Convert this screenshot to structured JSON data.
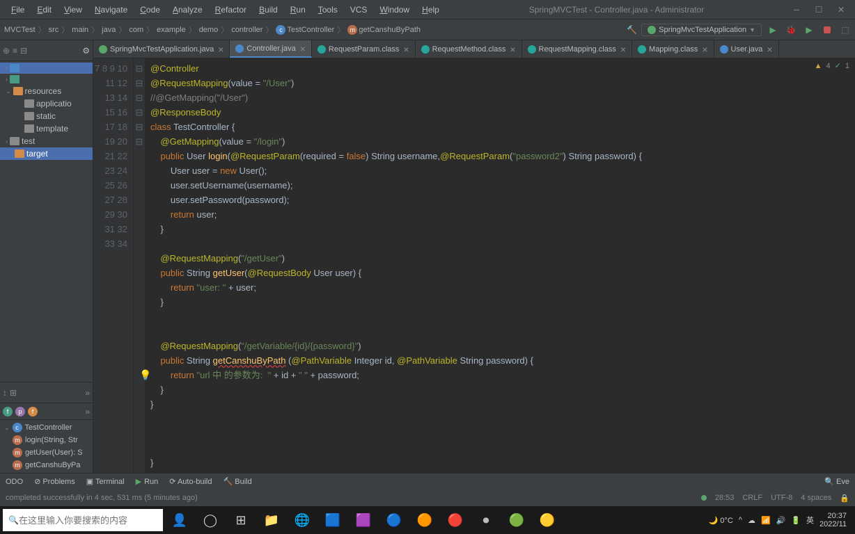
{
  "title": "SpringMVCTest - Controller.java - Administrator",
  "menu": [
    "File",
    "Edit",
    "View",
    "Navigate",
    "Code",
    "Analyze",
    "Refactor",
    "Build",
    "Run",
    "Tools",
    "VCS",
    "Window",
    "Help"
  ],
  "menu_underline": [
    0,
    0,
    0,
    0,
    0,
    0,
    0,
    0,
    0,
    0,
    -1,
    0,
    0
  ],
  "breadcrumbs": [
    "MVCTest",
    "src",
    "main",
    "java",
    "com",
    "example",
    "demo",
    "controller",
    "TestController",
    "getCanshuByPath"
  ],
  "run_config": "SpringMvcTestApplication",
  "tabs": [
    {
      "label": "SpringMvcTestApplication.java",
      "icon": "green",
      "active": false
    },
    {
      "label": "Controller.java",
      "icon": "blue",
      "active": true
    },
    {
      "label": "RequestParam.class",
      "icon": "teal",
      "active": false
    },
    {
      "label": "RequestMethod.class",
      "icon": "teal",
      "active": false
    },
    {
      "label": "RequestMapping.class",
      "icon": "teal",
      "active": false
    },
    {
      "label": "Mapping.class",
      "icon": "teal",
      "active": false
    },
    {
      "label": "User.java",
      "icon": "blue",
      "active": false
    }
  ],
  "tree": {
    "items": [
      {
        "label": "",
        "icon": "blue",
        "indent": 0,
        "chev": ">",
        "sel": true
      },
      {
        "label": "",
        "icon": "teal",
        "indent": 0,
        "chev": ">"
      },
      {
        "label": "resources",
        "icon": "orange",
        "indent": 0,
        "chev": "v"
      },
      {
        "label": "applicatio",
        "icon": "gray",
        "indent": 1
      },
      {
        "label": "static",
        "icon": "gray",
        "indent": 1
      },
      {
        "label": "template",
        "icon": "gray",
        "indent": 1
      },
      {
        "label": "test",
        "icon": "gray",
        "indent": -1,
        "chev": ">"
      },
      {
        "label": "target",
        "icon": "orange",
        "indent": -1,
        "sel": true
      }
    ]
  },
  "structure": {
    "class": "TestController",
    "methods": [
      "login(String, Str",
      "getUser(User): S",
      "getCanshuByPa"
    ]
  },
  "gutter_start": 7,
  "gutter_end": 34,
  "code_lines": [
    "<span class='ann'>@Controller</span>",
    "<span class='ann'>@RequestMapping</span>(value = <span class='str'>\"/User\"</span>)",
    "<span class='cmt'>//@GetMapping(\"/User\")</span>",
    "<span class='ann'>@ResponseBody</span>",
    "<span class='kw'>class</span> <span class='cls'>TestController</span> {",
    "    <span class='ann'>@GetMapping</span>(value = <span class='str'>\"/login\"</span>)",
    "    <span class='kw'>public</span> <span class='cls'>User</span> <span class='fn'>login</span>(<span class='ann'>@RequestParam</span>(required = <span class='kw'>false</span>) <span class='cls'>String</span> username,<span class='ann'>@RequestParam</span>(<span class='str'>\"password2\"</span>) <span class='cls'>String</span> password) {",
    "        <span class='cls'>User</span> user = <span class='kw'>new</span> User();",
    "        user.setUsername(username);",
    "        user.setPassword(password);",
    "        <span class='kw'>return</span> user;",
    "    }",
    "",
    "    <span class='ann'>@RequestMapping</span>(<span class='str'>\"/getUser\"</span>)",
    "    <span class='kw'>public</span> <span class='cls'>String</span> <span class='fn'>getUser</span>(<span class='ann'>@RequestBody</span> <span class='cls'>User</span> user) {",
    "        <span class='kw'>return</span> <span class='str'>\"user: \"</span> + user;",
    "    }",
    "",
    "",
    "    <span class='ann'>@RequestMapping</span>(<span class='str'>\"/getVariable/{id}/{password}\"</span>)",
    "    <span class='kw'>public</span> <span class='cls'>String</span> <span class='fn err-line'>getCanshuByPath</span> (<span class='ann'>@PathVariable</span> <span class='cls'>Integer</span> id, <span class='ann'>@PathVariable</span> <span class='cls'>String</span> password) {",
    "        <span class='kw'>return</span> <span class='str'>\"url 中 的参数为:  \"</span> + id + <span class='str'>\" \"</span> + password;",
    "    }",
    "}",
    "",
    "",
    "",
    "}"
  ],
  "inspector": {
    "warn": "4",
    "check": "1"
  },
  "bottom_tabs": [
    "ODO",
    "Problems",
    "Terminal",
    "Run",
    "Auto-build",
    "Build"
  ],
  "bottom_right": "Eve",
  "status_msg": "completed successfully in 4 sec, 531 ms (5 minutes ago)",
  "status_right": {
    "pos": "28:53",
    "eol": "CRLF",
    "enc": "UTF-8",
    "indent": "4 spaces"
  },
  "search_placeholder": "在这里输入你要搜索的内容",
  "weather": "0°C",
  "ime": "英",
  "clock": {
    "time": "20:37",
    "date": "2022/11"
  }
}
